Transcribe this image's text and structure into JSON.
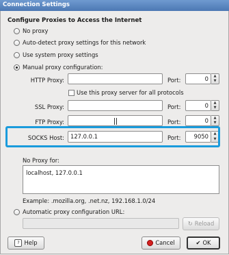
{
  "window": {
    "title": "Connection Settings"
  },
  "section_heading": "Configure Proxies to Access the Internet",
  "proxy_options": {
    "no_proxy": "No proxy",
    "auto_detect": "Auto-detect proxy settings for this network",
    "system": "Use system proxy settings",
    "manual": "Manual proxy configuration:",
    "selected": "manual"
  },
  "manual": {
    "http_label": "HTTP Proxy:",
    "http_value": "",
    "http_port": "0",
    "same_for_all_label": "Use this proxy server for all protocols",
    "ssl_label": "SSL Proxy:",
    "ssl_value": "",
    "ssl_port": "0",
    "ftp_label": "FTP Proxy:",
    "ftp_value": "",
    "ftp_port": "0",
    "socks_label": "SOCKS Host:",
    "socks_value": "127.0.0.1",
    "socks_port": "9050",
    "port_label": "Port:"
  },
  "no_proxy": {
    "label": "No Proxy for:",
    "value": "localhost, 127.0.0.1",
    "example": "Example: .mozilla.org, .net.nz, 192.168.1.0/24"
  },
  "auto_config": {
    "label": "Automatic proxy configuration URL:",
    "url_value": "",
    "reload_label": "Reload"
  },
  "buttons": {
    "help": "Help",
    "cancel": "Cancel",
    "ok": "OK"
  },
  "colors": {
    "highlight": "#1a9bdc",
    "titlebar": "#5a86c0"
  }
}
